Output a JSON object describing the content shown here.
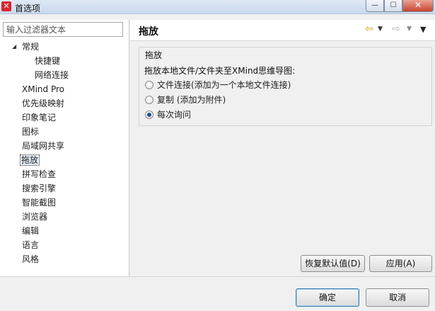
{
  "window": {
    "title": "首选项",
    "icon": "xmind-logo-icon",
    "controls": {
      "minimize": "—",
      "maximize": "☐",
      "close": "✕"
    }
  },
  "sidebar": {
    "filter_placeholder": "输入过滤器文本",
    "items": [
      {
        "label": "常规",
        "level": 0,
        "expanded": true
      },
      {
        "label": "快捷键",
        "level": 1
      },
      {
        "label": "网络连接",
        "level": 1
      },
      {
        "label": "XMind Pro",
        "level": 0
      },
      {
        "label": "优先级映射",
        "level": 0
      },
      {
        "label": "印象笔记",
        "level": 0
      },
      {
        "label": "图标",
        "level": 0
      },
      {
        "label": "局域网共享",
        "level": 0
      },
      {
        "label": "拖放",
        "level": 0,
        "selected": true
      },
      {
        "label": "拼写检查",
        "level": 0
      },
      {
        "label": "搜索引擎",
        "level": 0
      },
      {
        "label": "智能截图",
        "level": 0
      },
      {
        "label": "浏览器",
        "level": 0
      },
      {
        "label": "编辑",
        "level": 0
      },
      {
        "label": "语言",
        "level": 0
      },
      {
        "label": "风格",
        "level": 0
      }
    ]
  },
  "page": {
    "title": "拖放",
    "nav": {
      "back_icon": "back-arrow-icon",
      "forward_icon": "forward-arrow-icon",
      "menu_icon": "view-menu-icon"
    },
    "group": {
      "title": "拖放",
      "description": "拖放本地文件/文件夹至XMind思维导图:",
      "options": [
        {
          "label": "文件连接(添加为一个本地文件连接)",
          "checked": false
        },
        {
          "label": "复制 (添加为附件)",
          "checked": false
        },
        {
          "label": "每次询问",
          "checked": true
        }
      ]
    },
    "restore_defaults_label": "恢复默认值(D)",
    "apply_label": "应用(A)"
  },
  "dialog": {
    "ok_label": "确定",
    "cancel_label": "取消"
  },
  "colors": {
    "accent": "#3c7fb1",
    "back_arrow": "#d4a016",
    "close_button": "#c7452f"
  }
}
